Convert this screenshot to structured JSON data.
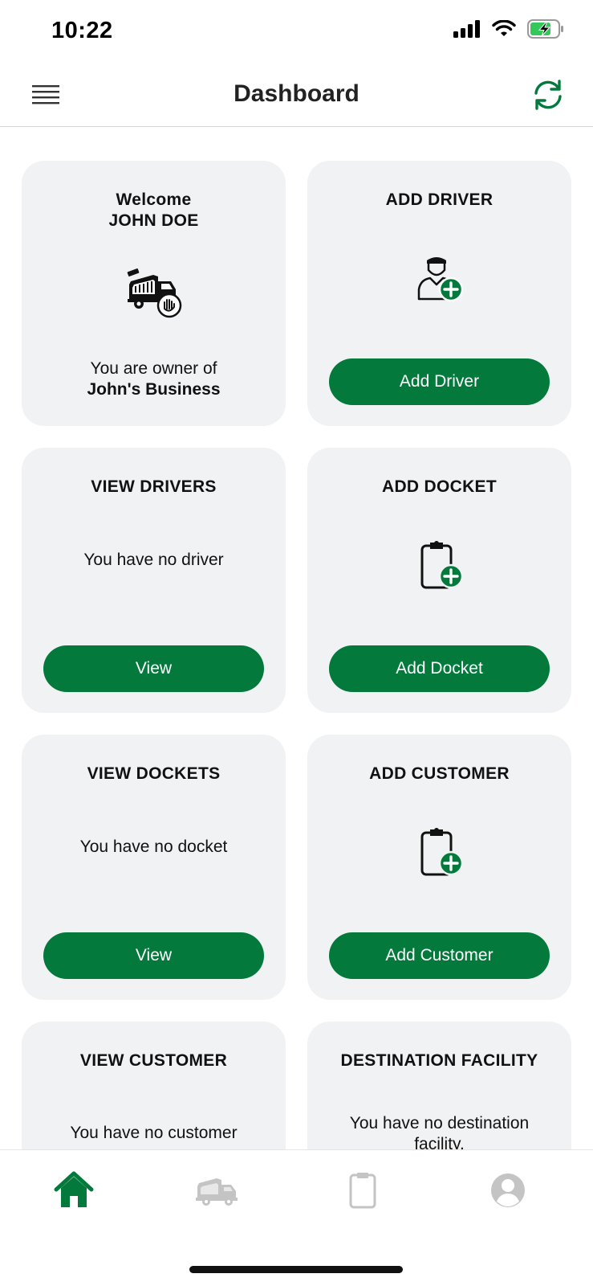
{
  "status_bar": {
    "time": "10:22"
  },
  "header": {
    "title": "Dashboard"
  },
  "colors": {
    "accent": "#037a3c",
    "card_bg": "#f1f2f4",
    "inactive_tab": "#c4c4c4"
  },
  "cards": {
    "welcome": {
      "title_line1": "Welcome",
      "title_line2": "JOHN DOE",
      "text_line1": "You are owner of",
      "text_line2": "John's Business",
      "icon": "garbage-truck-icon"
    },
    "add_driver": {
      "title": "ADD DRIVER",
      "button": "Add Driver",
      "icon": "driver-add-icon"
    },
    "view_drivers": {
      "title": "VIEW DRIVERS",
      "text": "You have no driver",
      "button": "View"
    },
    "add_docket": {
      "title": "ADD DOCKET",
      "button": "Add Docket",
      "icon": "clipboard-add-icon"
    },
    "view_dockets": {
      "title": "VIEW DOCKETS",
      "text": "You have no docket",
      "button": "View"
    },
    "add_customer": {
      "title": "ADD CUSTOMER",
      "button": "Add Customer",
      "icon": "clipboard-add-icon"
    },
    "view_customer": {
      "title": "VIEW CUSTOMER",
      "text": "You have no customer"
    },
    "destination_facility": {
      "title": "DESTINATION FACILITY",
      "text_line1": "You have no destination",
      "text_line2": "facility."
    }
  },
  "tabs": [
    {
      "name": "home",
      "icon": "home-icon",
      "active": true
    },
    {
      "name": "trucks",
      "icon": "truck-icon",
      "active": false
    },
    {
      "name": "dockets",
      "icon": "clipboard-icon",
      "active": false
    },
    {
      "name": "profile",
      "icon": "user-icon",
      "active": false
    }
  ]
}
